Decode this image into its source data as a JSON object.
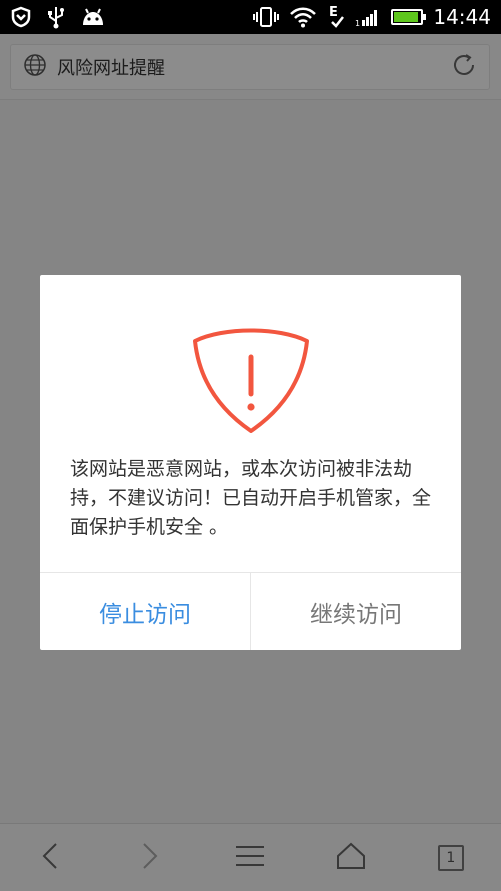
{
  "status_bar": {
    "time": "14:44",
    "network_letter": "E",
    "battery_level": 0.9,
    "icons_left": [
      "shield-icon",
      "usb-icon",
      "android-icon"
    ],
    "icons_right": [
      "vibrate-icon",
      "wifi-icon",
      "signal-icon",
      "battery-icon"
    ]
  },
  "address_bar": {
    "title": "风险网址提醒",
    "left_icon": "globe-icon",
    "right_icon": "refresh-icon"
  },
  "dialog": {
    "icon": "warning-shield-icon",
    "message": "该网站是恶意网站，或本次访问被非法劫持，不建议访问！已自动开启手机管家，全面保护手机安全 。",
    "stop_label": "停止访问",
    "continue_label": "继续访问",
    "colors": {
      "warning": "#f2563f",
      "primary": "#3a8de0",
      "secondary": "#777777"
    }
  },
  "bottom_bar": {
    "items": [
      "back-icon",
      "forward-icon",
      "menu-icon",
      "home-icon",
      "tabs-icon"
    ],
    "tab_count": "1"
  }
}
